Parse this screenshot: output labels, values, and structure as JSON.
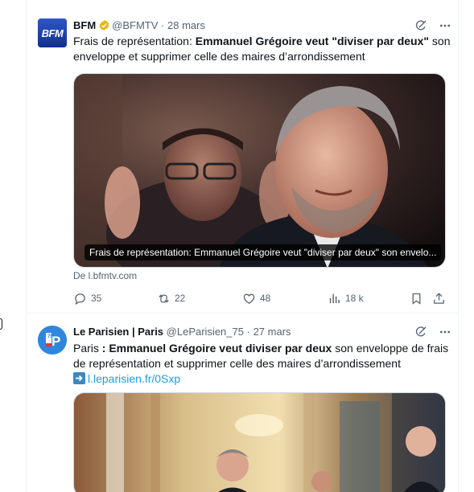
{
  "tweets": [
    {
      "author_name": "BFM",
      "avatar_text": "BFM",
      "handle": "@BFMTV",
      "separator": "·",
      "date": "28 mars",
      "text_parts": [
        "Frais de représentation: ",
        "Emmanuel Grégoire veut \"diviser par deux\"",
        " son enveloppe et supprimer celle des maires d’arrondissement"
      ],
      "media_caption": "Frais de représentation: Emmanuel Grégoire veut \"diviser par deux\" son envelo...",
      "source": "De l.bfmtv.com",
      "stats": {
        "replies": "35",
        "reposts": "22",
        "likes": "48",
        "views": "18 k"
      }
    },
    {
      "author_name": "Le Parisien | Paris",
      "handle": "@LeParisien_75",
      "separator": "·",
      "date": "27 mars",
      "avatar_text": "75",
      "avatar_letter": "P",
      "text_parts": [
        "Paris ",
        ": Emmanuel Grégoire veut diviser par deux",
        " son enveloppe de frais de représentation et supprimer celle des maires d’arrondissement"
      ],
      "link": "l.leparisien.fr/0Sxp"
    }
  ],
  "icons": {
    "verified": "verified-badge-icon",
    "grok": "grok-icon",
    "more": "more-icon",
    "reply": "reply-icon",
    "repost": "repost-icon",
    "like": "like-icon",
    "views": "views-icon",
    "bookmark": "bookmark-icon",
    "share": "share-icon",
    "link_arrow": "right-arrow-emoji-icon"
  },
  "colors": {
    "link": "#1d9bf0",
    "secondary_text": "#536471",
    "border": "#eff3f4",
    "verified_gold": "#e2b719"
  }
}
